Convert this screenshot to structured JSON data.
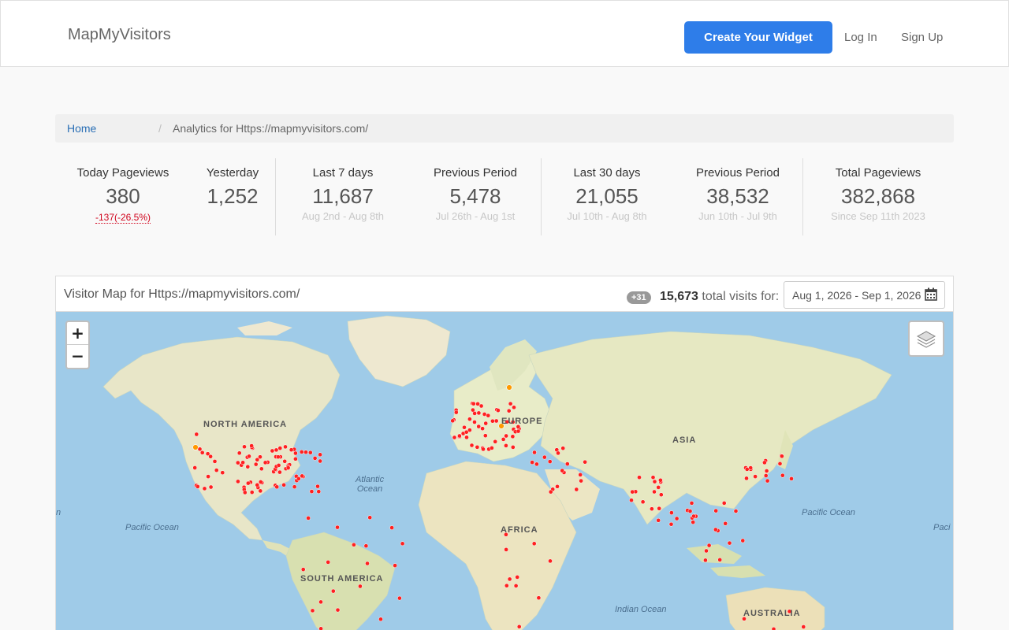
{
  "nav": {
    "brand": "MapMyVisitors",
    "cta": "Create Your Widget",
    "login": "Log In",
    "signup": "Sign Up"
  },
  "breadcrumb": {
    "home": "Home",
    "separator": "/",
    "current": "Analytics for Https://mapmyvisitors.com/"
  },
  "stats": {
    "today": {
      "label": "Today Pageviews",
      "value": "380",
      "delta": "-137(-26.5%)"
    },
    "yesterday": {
      "label": "Yesterday",
      "value": "1,252"
    },
    "last7": {
      "label": "Last 7 days",
      "value": "11,687",
      "range": "Aug 2nd - Aug 8th"
    },
    "prev7": {
      "label": "Previous Period",
      "value": "5,478",
      "range": "Jul 26th - Aug 1st"
    },
    "last30": {
      "label": "Last 30 days",
      "value": "21,055",
      "range": "Jul 10th - Aug 8th"
    },
    "prev30": {
      "label": "Previous Period",
      "value": "38,532",
      "range": "Jun 10th - Jul 9th"
    },
    "total": {
      "label": "Total Pageviews",
      "value": "382,868",
      "since": "Since Sep 11th 2023"
    }
  },
  "map_panel": {
    "title": "Visitor Map for Https://mapmyvisitors.com/",
    "badge": "+31",
    "total_visits": "15,673",
    "total_suffix": "total visits for:",
    "date_range": "Aug 1, 2026 - Sep 1, 2026",
    "zoom_in": "+",
    "zoom_out": "−",
    "labels": {
      "north_america": "NORTH AMERICA",
      "south_america": "SOUTH AMERICA",
      "europe": "EUROPE",
      "asia": "ASIA",
      "africa": "AFRICA",
      "australia": "AUSTRALIA",
      "atlantic_1": "Atlantic",
      "atlantic_2": "Ocean",
      "pacific_left": "Pacific Ocean",
      "pacific_right": "Pacific Ocean",
      "pacific_edge": "Paci",
      "indian": "Indian Ocean",
      "edge_n": "n"
    }
  },
  "colors": {
    "accent": "#2e7de9",
    "marker": "#ff2020",
    "marker_highlight": "#ff9900",
    "negative": "#d0021b"
  }
}
